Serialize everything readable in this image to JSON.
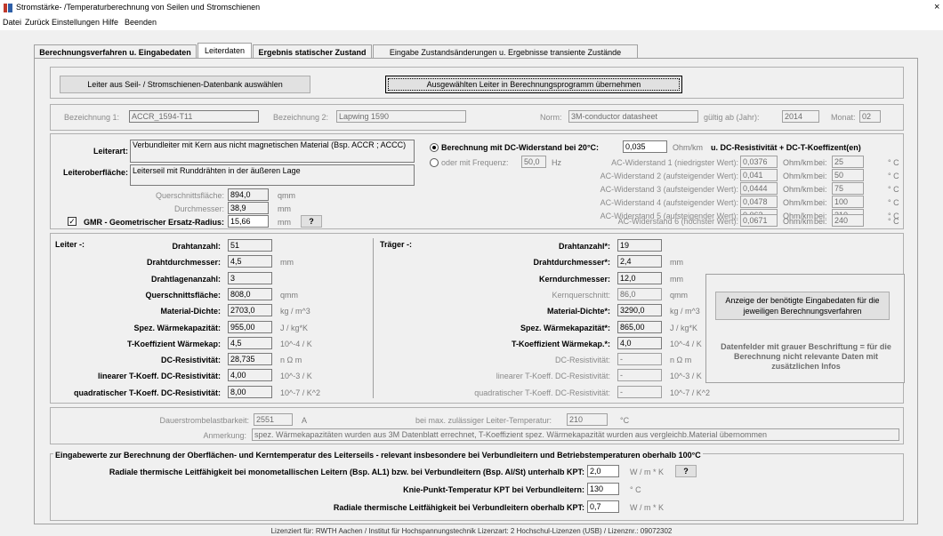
{
  "title_bar": {
    "title": "Stromstärke- /Temperaturberechnung von Seilen und Stromschienen",
    "close": "×"
  },
  "menu": [
    "Datei",
    "Zurück",
    "Einstellungen",
    "Hilfe",
    "Beenden"
  ],
  "tabs": [
    "Berechnungsverfahren u. Eingabedaten",
    "Leiterdaten",
    "Ergebnis statischer Zustand",
    "Eingabe Zustandsänderungen u. Ergebnisse transiente Zustände"
  ],
  "buttons": {
    "select_db": "Leiter aus Seil- / Stromschienen-Datenbank auswählen",
    "apply": "Ausgewählten Leiter in Berechnungsprogramm übernehmen",
    "info": "Anzeige der benötigte Eingabedaten für die jeweiligen Berechnungsverfahren",
    "question": "?"
  },
  "header": {
    "bez1_label": "Bezeichnung 1:",
    "bez1": "ACCR_1594-T11",
    "bez2_label": "Bezeichnung 2:",
    "bez2": "Lapwing 1590",
    "norm_label": "Norm:",
    "norm": "3M-conductor datasheet",
    "year_label": "gültig ab (Jahr):",
    "year": "2014",
    "month_label": "Monat:",
    "month": "02"
  },
  "conductor": {
    "leiterart_label": "Leiterart:",
    "leiterart": "Verbundleiter mit Kern aus nicht magnetischen Material (Bsp. ACCR ; ACCC)",
    "surface_label": "Leiteroberfläche:",
    "surface": "Leiterseil mit  Runddrähten in der äußeren Lage",
    "qs_label": "Querschnittsfläche:",
    "qs": "894,0",
    "qs_unit": "qmm",
    "d_label": "Durchmesser:",
    "d": "38,9",
    "d_unit": "mm",
    "gmr_label": "GMR - Geometrischer Ersatz-Radius:",
    "gmr": "15,66",
    "gmr_unit": "mm",
    "gmr_checked": "✓"
  },
  "resistance": {
    "dc_label": "Berechnung mit DC-Widerstand bei 20°C:",
    "dc": "0,035",
    "dc_unit": "Ohm/km",
    "dc_suffix": "u. DC-Resistivität + DC-T-Koeffizent(en)",
    "freq_label": "oder mit Frequenz:",
    "freq": "50,0",
    "freq_unit": "Hz",
    "ac_rows": [
      {
        "label": "AC-Widerstand 1 (niedrigster Wert):",
        "value": "0,0376",
        "unit": "Ohm/km",
        "bei": "bei:",
        "temp": "25",
        "tunit": "° C"
      },
      {
        "label": "AC-Widerstand 2 (aufsteigender Wert):",
        "value": "0,041",
        "unit": "Ohm/km",
        "bei": "bei:",
        "temp": "50",
        "tunit": "° C"
      },
      {
        "label": "AC-Widerstand 3 (aufsteigender Wert):",
        "value": "0,0444",
        "unit": "Ohm/km",
        "bei": "bei:",
        "temp": "75",
        "tunit": "° C"
      },
      {
        "label": "AC-Widerstand 4 (aufsteigender Wert):",
        "value": "0,0478",
        "unit": "Ohm/km",
        "bei": "bei:",
        "temp": "100",
        "tunit": "° C"
      },
      {
        "label": "AC-Widerstand 5 (aufsteigender Wert):",
        "value": "0,063",
        "unit": "Ohm/km",
        "bei": "bei:",
        "temp": "210",
        "tunit": "° C"
      },
      {
        "label": "AC-Widerstand 6 (höchster Wert):",
        "value": "0,0671",
        "unit": "Ohm/km",
        "bei": "bei:",
        "temp": "240",
        "tunit": "° C"
      }
    ]
  },
  "leiter": {
    "title": "Leiter -:",
    "rows": [
      {
        "label": "Drahtanzahl:",
        "value": "51",
        "unit": ""
      },
      {
        "label": "Drahtdurchmesser:",
        "value": "4,5",
        "unit": "mm"
      },
      {
        "label": "Drahtlagenanzahl:",
        "value": "3",
        "unit": ""
      },
      {
        "label": "Querschnittsfläche:",
        "value": "808,0",
        "unit": "qmm"
      },
      {
        "label": "Material-Dichte:",
        "value": "2703,0",
        "unit": "kg / m^3"
      },
      {
        "label": "Spez. Wärmekapazität:",
        "value": "955,00",
        "unit": "J / kg*K"
      },
      {
        "label": "T-Koeffizient Wärmekap:",
        "value": "4,5",
        "unit": "10^-4 / K"
      },
      {
        "label": "DC-Resistivität:",
        "value": "28,735",
        "unit": "n Ω m"
      },
      {
        "label": "linearer T-Koeff. DC-Resistivität:",
        "value": "4,00",
        "unit": "10^-3 / K"
      },
      {
        "label": "quadratischer T-Koeff. DC-Resistivität:",
        "value": "8,00",
        "unit": "10^-7 / K^2"
      }
    ]
  },
  "traeger": {
    "title": "Träger -:",
    "rows": [
      {
        "label": "Drahtanzahl*:",
        "value": "19",
        "unit": ""
      },
      {
        "label": "Drahtdurchmesser*:",
        "value": "2,4",
        "unit": "mm"
      },
      {
        "label": "Kerndurchmesser:",
        "value": "12,0",
        "unit": "mm"
      },
      {
        "label": "Kernquerschnitt:",
        "value": "86,0",
        "unit": "qmm"
      },
      {
        "label": "Material-Dichte*:",
        "value": "3290,0",
        "unit": "kg / m^3"
      },
      {
        "label": "Spez. Wärmekapazität*:",
        "value": "865,00",
        "unit": "J / kg*K"
      },
      {
        "label": "T-Koeffizient Wärmekap.*:",
        "value": "4,0",
        "unit": "10^-4 / K"
      },
      {
        "label": "DC-Resistivität:",
        "value": "-",
        "unit": "n Ω m"
      },
      {
        "label": "linearer T-Koeff. DC-Resistivität:",
        "value": "-",
        "unit": "10^-3 / K"
      },
      {
        "label": "quadratischer T-Koeff. DC-Resistivität:",
        "value": "-",
        "unit": "10^-7 / K^2"
      }
    ]
  },
  "info_note": "Datenfelder mit grauer Beschriftung = für die Berechnung nicht relevante Daten mit zusätzlichen Infos",
  "bottom": {
    "dauer_label": "Dauerstrombelastbarkeit:",
    "dauer": "2551",
    "dauer_unit": "A",
    "temp_label": "bei max. zulässiger Leiter-Temperatur:",
    "temp": "210",
    "temp_unit": "°C",
    "anm_label": "Anmerkung:",
    "anm": "spez. Wärmekapazitäten wurden aus 3M Datenblatt errechnet, T-Koeffizient spez. Wärmekapazität wurden aus vergleichb.Material übernommen"
  },
  "thermal": {
    "title": "Eingabewerte zur Berechnung der Oberflächen- und Kerntemperatur des Leiterseils - relevant insbesondere bei Verbundleitern und Betriebstemperaturen oberhalb 100°C",
    "r1_label": "Radiale thermische Leitfähigkeit bei monometallischen Leitern (Bsp. AL1) bzw. bei Verbundleitern (Bsp. Al/St) unterhalb KPT:",
    "r1": "2,0",
    "r1_unit": "W / m * K",
    "kpt_label": "Knie-Punkt-Temperatur KPT bei Verbundleitern:",
    "kpt": "130",
    "kpt_unit": "° C",
    "r2_label": "Radiale thermische Leitfähigkeit bei Verbundleitern oberhalb KPT:",
    "r2": "0,7",
    "r2_unit": "W / m * K"
  },
  "footer": "Lizenziert für: RWTH Aachen / Institut für Hochspannungstechnik Lizenzart:  2 Hochschul-Lizenzen (USB) / Lizenznr.: 09072302"
}
